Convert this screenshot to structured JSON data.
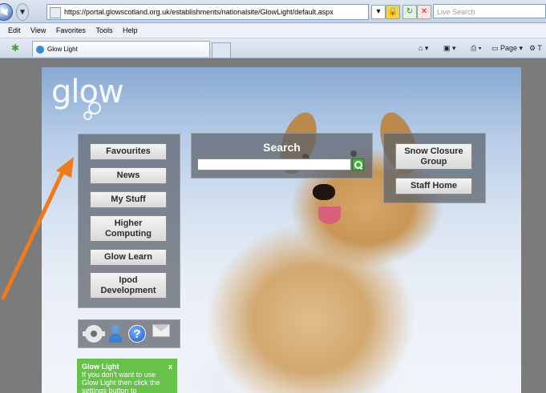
{
  "browser": {
    "url": "https://portal.glowscotland.org.uk/establishments/nationalsite/GlowLight/default.aspx",
    "search_placeholder": "Live Search",
    "menu": [
      "Edit",
      "View",
      "Favorites",
      "Tools",
      "Help"
    ],
    "tab_title": "Glow Light",
    "commands": {
      "page": "Page",
      "tools": "T"
    }
  },
  "site": {
    "logo": "glow",
    "left_menu": [
      {
        "id": "favourites",
        "label": "Favourites"
      },
      {
        "id": "news",
        "label": "News"
      },
      {
        "id": "my-stuff",
        "label": "My Stuff"
      },
      {
        "id": "higher-computing",
        "label": "Higher Computing"
      },
      {
        "id": "glow-learn",
        "label": "Glow Learn"
      },
      {
        "id": "ipod-development",
        "label": "Ipod Development"
      }
    ],
    "search": {
      "label": "Search",
      "value": ""
    },
    "right_menu": [
      {
        "id": "snow-closure-group",
        "label": "Snow Closure Group"
      },
      {
        "id": "staff-home",
        "label": "Staff Home"
      }
    ],
    "icons": [
      "settings-icon",
      "person-icon",
      "help-icon",
      "mail-icon"
    ],
    "notification": {
      "title": "Glow Light",
      "close": "x",
      "text": "If you don't want to use Glow Light then click the settings button to"
    }
  },
  "colors": {
    "arrow": "#f07a1a",
    "notification_bg": "#67c24a",
    "panel": "#5a6069"
  }
}
